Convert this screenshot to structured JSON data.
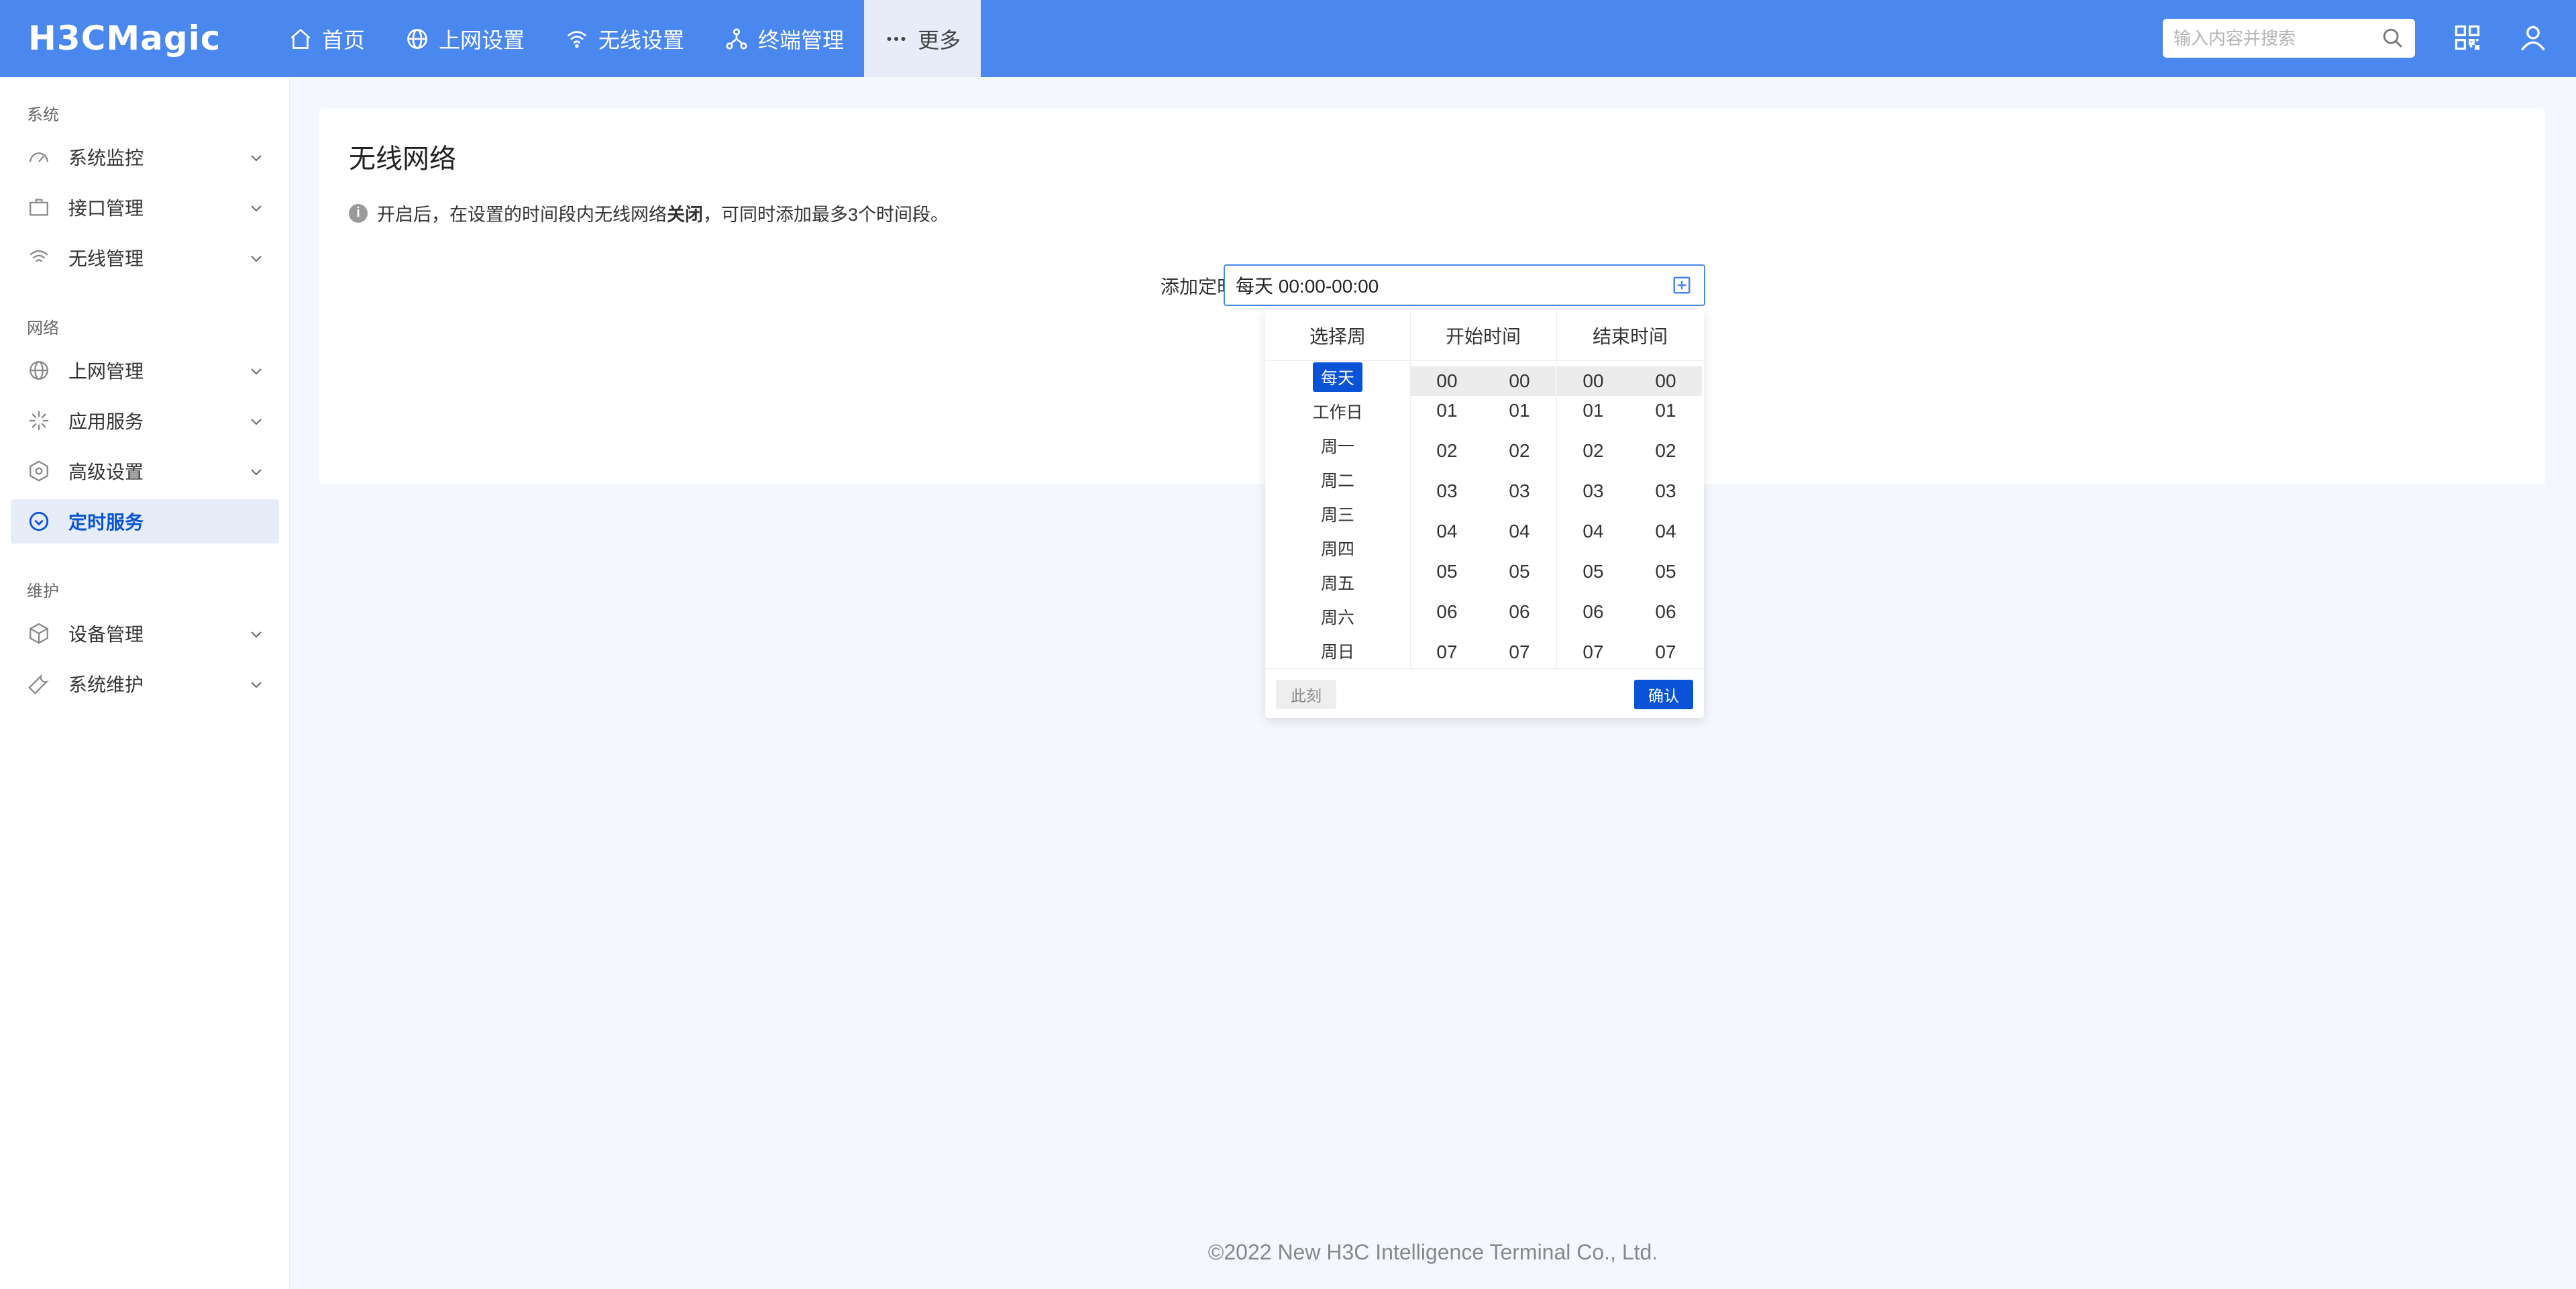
{
  "header": {
    "logo": "H3CMagic",
    "nav": [
      {
        "label": "首页",
        "icon": "home-icon"
      },
      {
        "label": "上网设置",
        "icon": "globe-icon"
      },
      {
        "label": "无线设置",
        "icon": "wifi-icon"
      },
      {
        "label": "终端管理",
        "icon": "network-icon"
      },
      {
        "label": "更多",
        "icon": "more-icon"
      }
    ],
    "search_placeholder": "输入内容并搜索"
  },
  "sidebar": {
    "groups": [
      {
        "label": "系统",
        "items": [
          "系统监控",
          "接口管理",
          "无线管理"
        ]
      },
      {
        "label": "网络",
        "items": [
          "上网管理",
          "应用服务",
          "高级设置",
          "定时服务"
        ]
      },
      {
        "label": "维护",
        "items": [
          "设备管理",
          "系统维护"
        ]
      }
    ],
    "active": "定时服务"
  },
  "main": {
    "title": "无线网络",
    "notice_prefix": "开启后，在设置的时间段内无线网络",
    "notice_bold": "关闭",
    "notice_suffix": "，可同时添加最多3个时间段。",
    "add_label": "添加定时",
    "input_value": "每天 00:00-00:00"
  },
  "picker": {
    "headers": {
      "week": "选择周",
      "start": "开始时间",
      "end": "结束时间"
    },
    "weeks": [
      "每天",
      "工作日",
      "周一",
      "周二",
      "周三",
      "周四",
      "周五",
      "周六",
      "周日"
    ],
    "selected_week": "每天",
    "numbers": [
      "00",
      "01",
      "02",
      "03",
      "04",
      "05",
      "06",
      "07"
    ],
    "now_label": "此刻",
    "ok_label": "确认"
  },
  "footer": "©2022 New H3C Intelligence Terminal Co., Ltd.",
  "colors": {
    "primary": "#4a87ee",
    "accent": "#0a53d6"
  }
}
